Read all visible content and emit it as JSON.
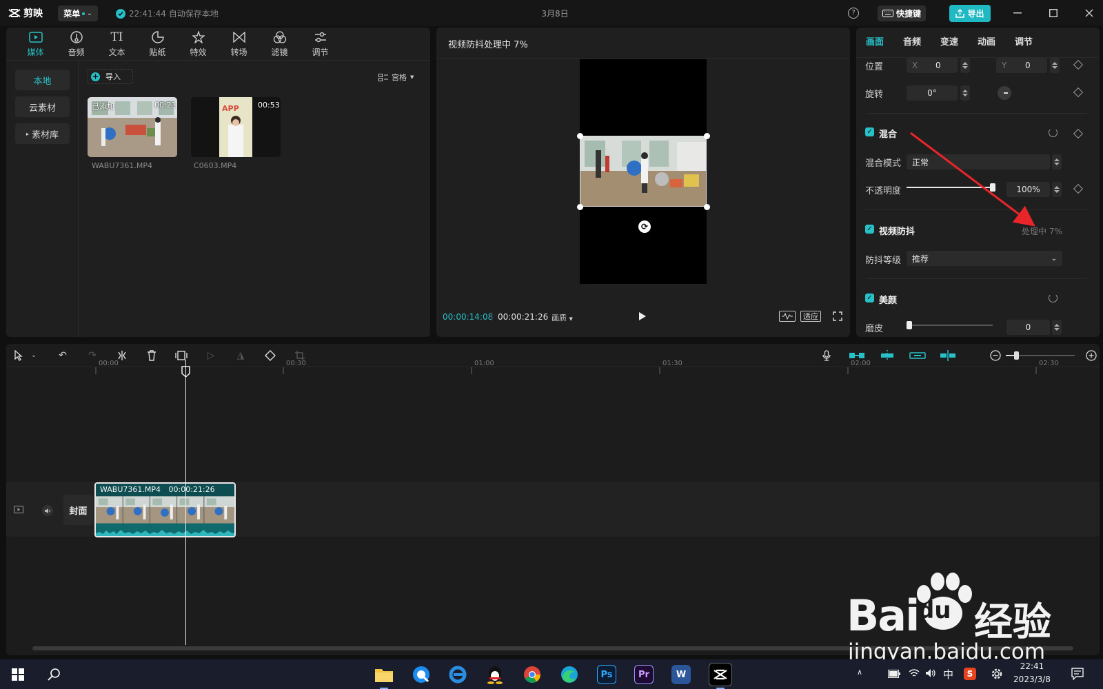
{
  "titlebar": {
    "app_name": "剪映",
    "menu_label": "菜单",
    "autosave_text": "22:41:44 自动保存本地",
    "project_title": "3月8日",
    "shortcut_label": "快捷键",
    "export_label": "导出"
  },
  "media": {
    "tabs": [
      {
        "label": "媒体",
        "icon": "media-icon"
      },
      {
        "label": "音频",
        "icon": "audio-icon"
      },
      {
        "label": "文本",
        "icon": "text-icon"
      },
      {
        "label": "贴纸",
        "icon": "sticker-icon"
      },
      {
        "label": "特效",
        "icon": "effects-icon"
      },
      {
        "label": "转场",
        "icon": "transition-icon"
      },
      {
        "label": "滤镜",
        "icon": "filter-icon"
      },
      {
        "label": "调节",
        "icon": "adjust-icon"
      }
    ],
    "text_tab_glyph": "TI",
    "side_nav": [
      "本地",
      "云素材",
      "素材库"
    ],
    "import_label": "导入",
    "view_label": "宫格",
    "clips": [
      {
        "name": "WABU7361.MP4",
        "badge": "已添加",
        "duration": "00:21"
      },
      {
        "name": "C0603.MP4",
        "duration": "00:53",
        "sign_text": "APP"
      }
    ]
  },
  "preview": {
    "title": "视频防抖处理中 7%",
    "current_time": "00:00:14:08",
    "total_time": "00:00:21:26",
    "quality_label": "画质",
    "fit_label": "适应"
  },
  "props": {
    "tabs": [
      "画面",
      "音频",
      "变速",
      "动画",
      "调节"
    ],
    "position_label": "位置",
    "x_label": "X",
    "x_value": "0",
    "y_label": "Y",
    "y_value": "0",
    "rotation_label": "旋转",
    "rotation_value": "0°",
    "blend_title": "混合",
    "blend_mode_label": "混合模式",
    "blend_mode_value": "正常",
    "opacity_label": "不透明度",
    "opacity_value": "100%",
    "opacity_level": 1.0,
    "stabilize_title": "视频防抖",
    "stabilize_status": "处理中 7%",
    "stabilize_level_label": "防抖等级",
    "stabilize_level_value": "推荐",
    "beauty_title": "美颜",
    "smooth_label": "磨皮",
    "smooth_value": "0",
    "smooth_level": 0.0
  },
  "timeline": {
    "ruler_labels": [
      "00:00",
      "00:30",
      "01:00",
      "01:30",
      "02:00",
      "02:30"
    ],
    "clip_name": "WABU7361.MP4",
    "clip_duration": "00:00:21:26",
    "cover_label": "封面"
  },
  "watermark": {
    "brand_left": "Bai",
    "brand_right": "du",
    "brand_cn": "经验",
    "url": "jingyan.baidu.com"
  },
  "taskbar": {
    "apps": [
      "file-explorer-icon",
      "qq-browser-icon",
      "ie-icon",
      "qq-icon",
      "chrome-icon",
      "edge-icon",
      "photoshop-icon",
      "premiere-icon",
      "word-icon",
      "capcut-icon"
    ],
    "ps_label": "Ps",
    "pr_label": "Pr",
    "word_label": "W",
    "ime_label": "中",
    "time": "22:41",
    "date": "2023/3/8"
  },
  "colors": {
    "accent": "#27c2c9",
    "annotation_arrow": "#e8262a"
  }
}
